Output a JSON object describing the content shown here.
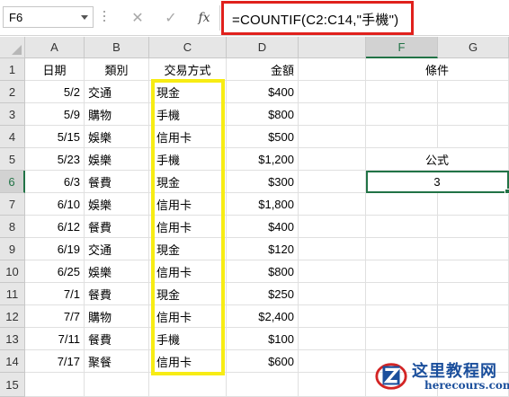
{
  "formula_bar": {
    "name_box": "F6",
    "cancel_icon": "close-icon",
    "enter_icon": "check-icon",
    "function_icon": "fx-icon",
    "function_label": "fx",
    "formula": "=COUNTIF(C2:C14,\"手機\")"
  },
  "columns": [
    "A",
    "B",
    "C",
    "D",
    "F",
    "G"
  ],
  "selected_column": "F",
  "rows": [
    "1",
    "2",
    "3",
    "4",
    "5",
    "6",
    "7",
    "8",
    "9",
    "10",
    "11",
    "12",
    "13",
    "14",
    "15"
  ],
  "selected_row": "6",
  "table": {
    "headers": {
      "date": "日期",
      "category": "類別",
      "payment": "交易方式",
      "amount": "金額"
    },
    "records": [
      {
        "date": "5/2",
        "category": "交通",
        "payment": "現金",
        "amount": "$400"
      },
      {
        "date": "5/9",
        "category": "購物",
        "payment": "手機",
        "amount": "$800"
      },
      {
        "date": "5/15",
        "category": "娛樂",
        "payment": "信用卡",
        "amount": "$500"
      },
      {
        "date": "5/23",
        "category": "娛樂",
        "payment": "手機",
        "amount": "$1,200"
      },
      {
        "date": "6/3",
        "category": "餐費",
        "payment": "現金",
        "amount": "$300"
      },
      {
        "date": "6/10",
        "category": "娛樂",
        "payment": "信用卡",
        "amount": "$1,800"
      },
      {
        "date": "6/12",
        "category": "餐費",
        "payment": "信用卡",
        "amount": "$400"
      },
      {
        "date": "6/19",
        "category": "交通",
        "payment": "現金",
        "amount": "$120"
      },
      {
        "date": "6/25",
        "category": "娛樂",
        "payment": "信用卡",
        "amount": "$800"
      },
      {
        "date": "7/1",
        "category": "餐費",
        "payment": "現金",
        "amount": "$250"
      },
      {
        "date": "7/7",
        "category": "購物",
        "payment": "信用卡",
        "amount": "$2,400"
      },
      {
        "date": "7/11",
        "category": "餐費",
        "payment": "手機",
        "amount": "$100"
      },
      {
        "date": "7/17",
        "category": "聚餐",
        "payment": "信用卡",
        "amount": "$600"
      }
    ]
  },
  "side": {
    "condition_label": "條件",
    "formula_label": "公式",
    "result": "3"
  },
  "watermark": {
    "title": "这里教程网",
    "url": "herecours.com"
  },
  "colors": {
    "formula_highlight": "#e0201c",
    "column_highlight": "#f7ec14",
    "selection": "#217346"
  }
}
